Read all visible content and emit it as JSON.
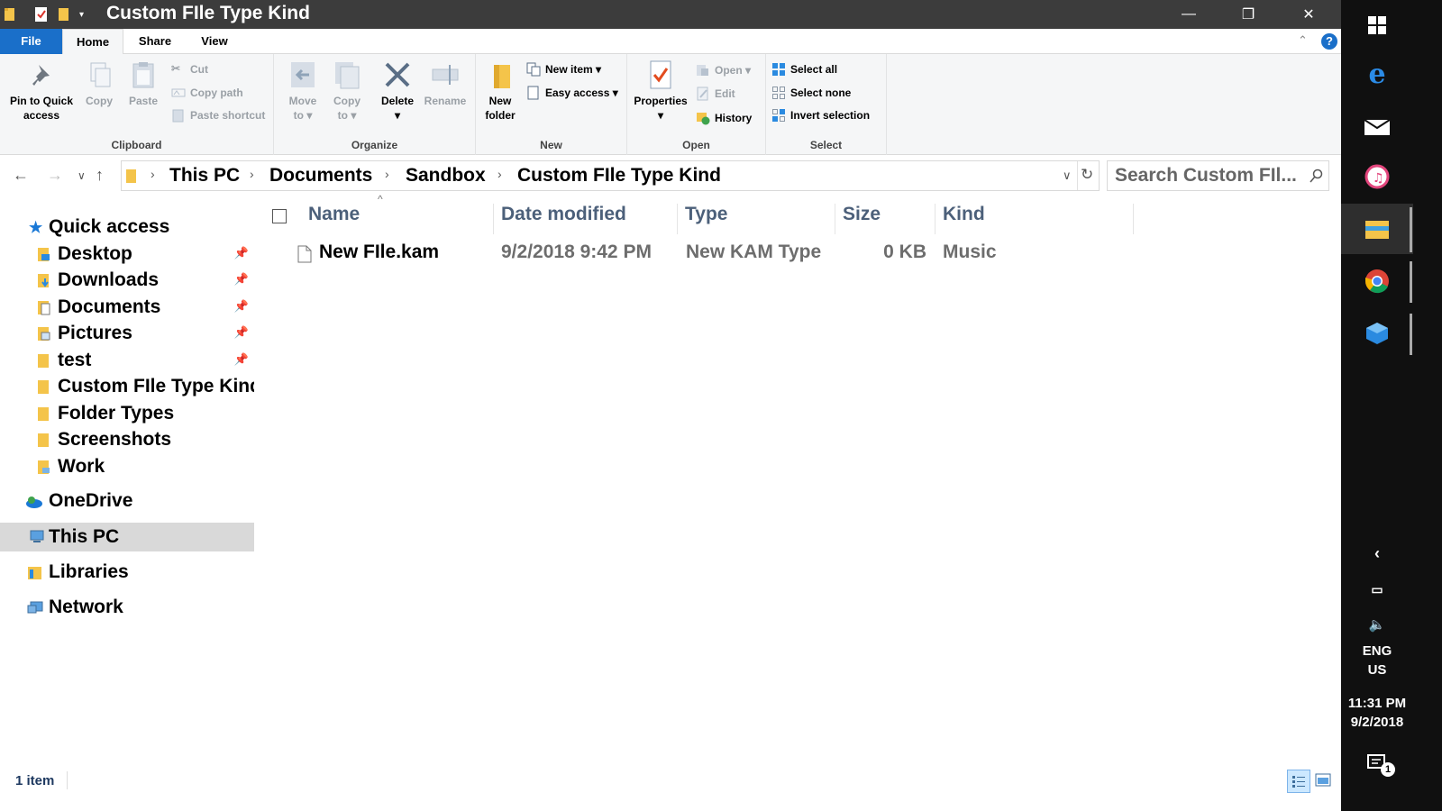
{
  "window": {
    "title": "Custom FIle Type Kind",
    "controls": {
      "minimize": "—",
      "restore": "❐",
      "close": "✕"
    }
  },
  "ribbon_tabs": {
    "file": "File",
    "home": "Home",
    "share": "Share",
    "view": "View"
  },
  "ribbon": {
    "clipboard": {
      "label": "Clipboard",
      "pin_line1": "Pin to Quick",
      "pin_line2": "access",
      "copy": "Copy",
      "paste": "Paste",
      "cut": "Cut",
      "copy_path": "Copy path",
      "paste_shortcut": "Paste shortcut"
    },
    "organize": {
      "label": "Organize",
      "move_line1": "Move",
      "move_line2": "to",
      "copy_line1": "Copy",
      "copy_line2": "to",
      "delete": "Delete",
      "rename": "Rename"
    },
    "new": {
      "label": "New",
      "folder_line1": "New",
      "folder_line2": "folder",
      "new_item": "New item",
      "easy_access": "Easy access"
    },
    "open": {
      "label": "Open",
      "properties": "Properties",
      "open": "Open",
      "edit": "Edit",
      "history": "History"
    },
    "select": {
      "label": "Select",
      "select_all": "Select all",
      "select_none": "Select none",
      "invert": "Invert selection"
    }
  },
  "address": {
    "crumbs": [
      "This PC",
      "Documents",
      "Sandbox",
      "Custom FIle Type Kind"
    ]
  },
  "search": {
    "placeholder": "Search Custom FIl..."
  },
  "nav": {
    "quick_access": "Quick access",
    "pinned": [
      {
        "label": "Desktop",
        "pinned": true
      },
      {
        "label": "Downloads",
        "pinned": true
      },
      {
        "label": "Documents",
        "pinned": true
      },
      {
        "label": "Pictures",
        "pinned": true
      },
      {
        "label": "test",
        "pinned": true
      },
      {
        "label": "Custom FIle Type Kind",
        "pinned": false
      },
      {
        "label": "Folder Types",
        "pinned": false
      },
      {
        "label": "Screenshots",
        "pinned": false
      },
      {
        "label": "Work",
        "pinned": false
      }
    ],
    "onedrive": "OneDrive",
    "this_pc": "This PC",
    "libraries": "Libraries",
    "network": "Network"
  },
  "columns": {
    "name": "Name",
    "date": "Date modified",
    "type": "Type",
    "size": "Size",
    "kind": "Kind"
  },
  "files": [
    {
      "name": "New FIle.kam",
      "date": "9/2/2018 9:42 PM",
      "type": "New KAM Type",
      "size": "0 KB",
      "kind": "Music"
    }
  ],
  "status": {
    "count": "1 item"
  },
  "tray": {
    "lang1": "ENG",
    "lang2": "US",
    "time": "11:31 PM",
    "date": "9/2/2018",
    "notifications": "1"
  },
  "colors": {
    "file_tab": "#1a6fc9",
    "titlebar": "#3c3c3c",
    "header_text": "#4c607a",
    "taskbar": "#101010"
  }
}
